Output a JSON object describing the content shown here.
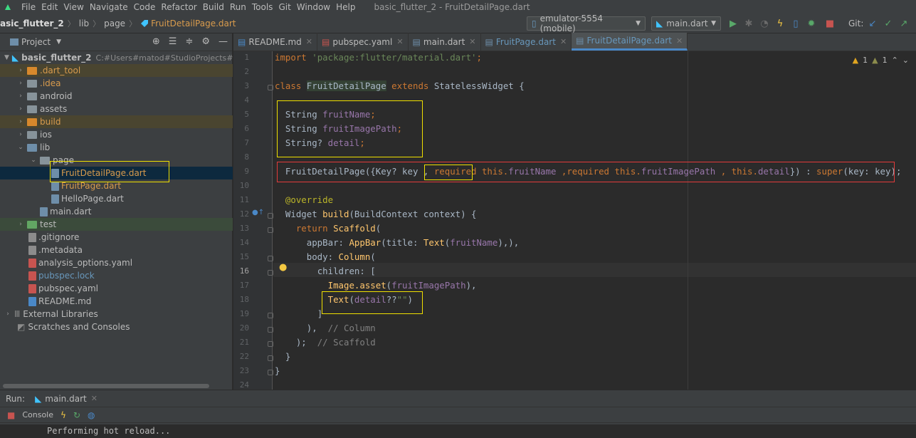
{
  "menubar": {
    "items": [
      "File",
      "Edit",
      "View",
      "Navigate",
      "Code",
      "Refactor",
      "Build",
      "Run",
      "Tools",
      "Git",
      "Window",
      "Help"
    ],
    "window_title": "basic_flutter_2 - FruitDetailPage.dart"
  },
  "navbar": {
    "crumbs": [
      "asic_flutter_2",
      "lib",
      "page",
      "FruitDetailPage.dart"
    ],
    "device": "emulator-5554 (mobile)",
    "run_config": "main.dart",
    "git_label": "Git:"
  },
  "project": {
    "header": "Project",
    "tree": [
      {
        "label": "basic_flutter_2",
        "path": "C:#Users#matod#StudioProjects#basic_fl",
        "level": 0,
        "type": "root"
      },
      {
        "label": ".dart_tool",
        "level": 1,
        "type": "folder-orange"
      },
      {
        "label": ".idea",
        "level": 1,
        "type": "folder-idea"
      },
      {
        "label": "android",
        "level": 1,
        "type": "folder"
      },
      {
        "label": "assets",
        "level": 1,
        "type": "folder"
      },
      {
        "label": "build",
        "level": 1,
        "type": "folder-orange"
      },
      {
        "label": "ios",
        "level": 1,
        "type": "folder"
      },
      {
        "label": "lib",
        "level": 1,
        "type": "folder-blue"
      },
      {
        "label": "page",
        "level": 2,
        "type": "folder"
      },
      {
        "label": "FruitDetailPage.dart",
        "level": 3,
        "type": "dart"
      },
      {
        "label": "FruitPage.dart",
        "level": 3,
        "type": "dart"
      },
      {
        "label": "HelloPage.dart",
        "level": 3,
        "type": "dart"
      },
      {
        "label": "main.dart",
        "level": 2,
        "type": "dart"
      },
      {
        "label": "test",
        "level": 1,
        "type": "folder-green"
      },
      {
        "label": ".gitignore",
        "level": 1,
        "type": "file"
      },
      {
        "label": ".metadata",
        "level": 1,
        "type": "file"
      },
      {
        "label": "analysis_options.yaml",
        "level": 1,
        "type": "yaml"
      },
      {
        "label": "pubspec.lock",
        "level": 1,
        "type": "yaml"
      },
      {
        "label": "pubspec.yaml",
        "level": 1,
        "type": "yaml"
      },
      {
        "label": "README.md",
        "level": 1,
        "type": "md"
      },
      {
        "label": "External Libraries",
        "level": 0,
        "type": "libs"
      },
      {
        "label": "Scratches and Consoles",
        "level": 0,
        "type": "scratch"
      }
    ]
  },
  "tabs": [
    "README.md",
    "pubspec.yaml",
    "main.dart",
    "FruitPage.dart",
    "FruitDetailPage.dart"
  ],
  "editor": {
    "warnings": {
      "a": "1",
      "b": "1"
    },
    "lines": [
      "1",
      "2",
      "3",
      "4",
      "5",
      "6",
      "7",
      "8",
      "9",
      "10",
      "11",
      "12",
      "13",
      "14",
      "15",
      "16",
      "17",
      "18",
      "19",
      "20",
      "21",
      "22",
      "23",
      "24"
    ],
    "code": {
      "l1_kw": "import",
      "l1_str": "'package:flutter/material.dart'",
      "l1_end": ";",
      "l3_kw1": "class",
      "l3_name": "FruitDetailPage",
      "l3_kw2": "extends",
      "l3_rest": "StatelessWidget {",
      "l5_type": "String",
      "l5_field": "fruitName",
      "l6_type": "String",
      "l6_field": "fruitImagePath",
      "l7_type": "String?",
      "l7_field": "detail",
      "l9_a": "FruitDetailPage({Key? key ,",
      "l9_req1": "required",
      "l9_this1": "this.",
      "l9_f1": "fruitName",
      "l9_sep1": " ,",
      "l9_req2": "required",
      "l9_this2": "this.",
      "l9_f2": "fruitImagePath",
      "l9_sep2": " ,",
      "l9_this3": "this.",
      "l9_f3": "detail",
      "l9_b": "}) : ",
      "l9_super": "super",
      "l9_c": "(key: key);",
      "l11": "@override",
      "l12_a": "Widget ",
      "l12_fn": "build",
      "l12_b": "(BuildContext context) {",
      "l13_kw": "return",
      "l13_fn": "Scaffold",
      "l13_b": "(",
      "l14_a": "appBar: ",
      "l14_fn": "AppBar",
      "l14_b": "(title: ",
      "l14_fn2": "Text",
      "l14_c": "(",
      "l14_f": "fruitName",
      "l14_d": "),),",
      "l15_a": "body: ",
      "l15_fn": "Column",
      "l15_b": "(",
      "l16": "children: [",
      "l17_fn": "Image.asset",
      "l17_a": "(",
      "l17_f": "fruitImagePath",
      "l17_b": "),",
      "l18_fn": "Text",
      "l18_a": "(",
      "l18_f": "detail",
      "l18_b": "??",
      "l18_str": "\"\"",
      "l18_c": ")",
      "l19": "]",
      "l20_a": "),",
      "l20_cmt": "// Column",
      "l21_a": ");",
      "l21_cmt": "// Scaffold",
      "l22": "}",
      "l23": "}"
    }
  },
  "run_panel": {
    "label": "Run:",
    "config": "main.dart",
    "console_tab": "Console",
    "output": "Performing hot reload..."
  }
}
